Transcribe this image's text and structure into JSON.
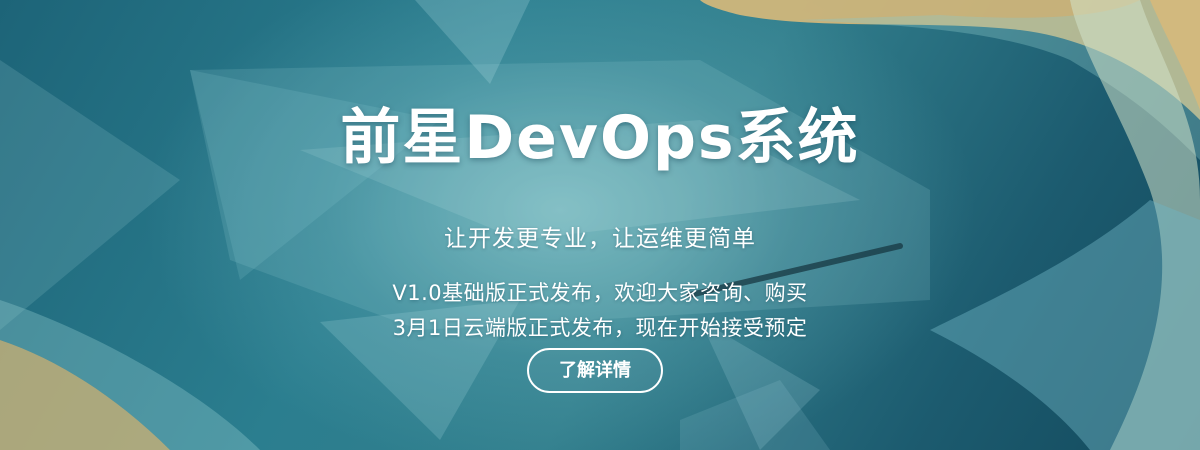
{
  "banner": {
    "title": "前星DevOps系统",
    "subtitle": "让开发更专业，让运维更简单",
    "lines": [
      "V1.0基础版正式发布，欢迎大家咨询、购买",
      "3月1日云端版正式发布，现在开始接受预定"
    ],
    "cta_label": "了解详情"
  },
  "colors": {
    "background": "#1d6478",
    "accent_gold": "#d9b878",
    "text": "#ffffff"
  }
}
